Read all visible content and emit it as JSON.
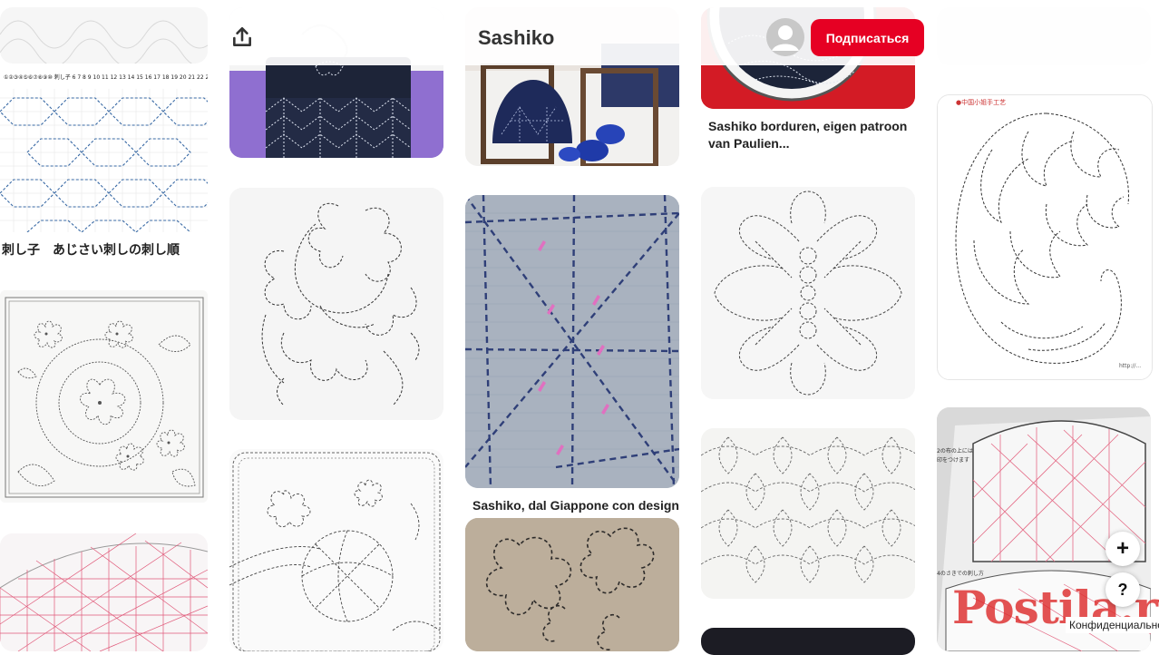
{
  "header": {
    "board_title": "Sashiko",
    "subscribe_label": "Подписаться"
  },
  "pins": {
    "col1_caption": "刺し子　あじさい刺しの刺し順",
    "col3_caption": "Sashiko, dal Giappone con design",
    "col4_caption_line1": "Sashiko borduren, eigen patroon",
    "col4_caption_line2": "van Paulien..."
  },
  "fabs": {
    "add": "+",
    "help": "?"
  },
  "footer": {
    "privacy": "Конфиденциальность"
  },
  "watermark": "Postila.ru",
  "colors": {
    "accent": "#e60023",
    "navy": "#1d2438",
    "purple": "#9d6bd6"
  }
}
